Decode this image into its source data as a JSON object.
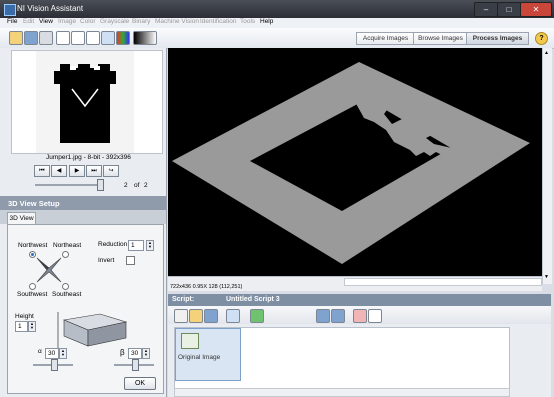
{
  "window": {
    "title": "NI Vision Assistant",
    "minimize": "–",
    "maximize": "□",
    "close": "✕"
  },
  "menu": {
    "file": "File",
    "edit": "Edit",
    "view": "View",
    "image": "Image",
    "color": "Color",
    "grayscale": "Grayscale",
    "binary": "Binary",
    "machine_vision": "Machine Vision",
    "identification": "Identification",
    "tools": "Tools",
    "help": "Help"
  },
  "modes": {
    "acquire": "Acquire Images",
    "browse": "Browse Images",
    "process": "Process Images",
    "help": "?"
  },
  "thumbnail": {
    "caption": "Jumper1.jpg - 8-bit - 392x396",
    "page_current": "2",
    "page_of": "of",
    "page_total": "2",
    "slider_fraction": 1.0
  },
  "nav": {
    "first": "⏮",
    "prev": "◀",
    "next": "▶",
    "last": "⏭",
    "loop": "↪"
  },
  "setup": {
    "header": "3D View Setup",
    "tab": "3D View",
    "northwest": "Northwest",
    "northeast": "Northeast",
    "southwest": "Southwest",
    "southeast": "Southeast",
    "selected_direction": "Northwest",
    "reduction_label": "Reduction",
    "reduction_value": "1",
    "invert_label": "Invert",
    "invert_checked": false,
    "height_label": "Height",
    "height_value": "1",
    "alpha_label": "α",
    "alpha_value": "30",
    "beta_label": "β",
    "beta_value": "30",
    "ok": "OK"
  },
  "viewer": {
    "status": "722x436 0.95X 128     (112,251)"
  },
  "script": {
    "label": "Script:",
    "name": "Untitled Script 3",
    "step": "Original Image"
  },
  "colors": {
    "accent": "#2f6fbf",
    "canvas": "#000000",
    "plate": "#9a9a9a"
  }
}
